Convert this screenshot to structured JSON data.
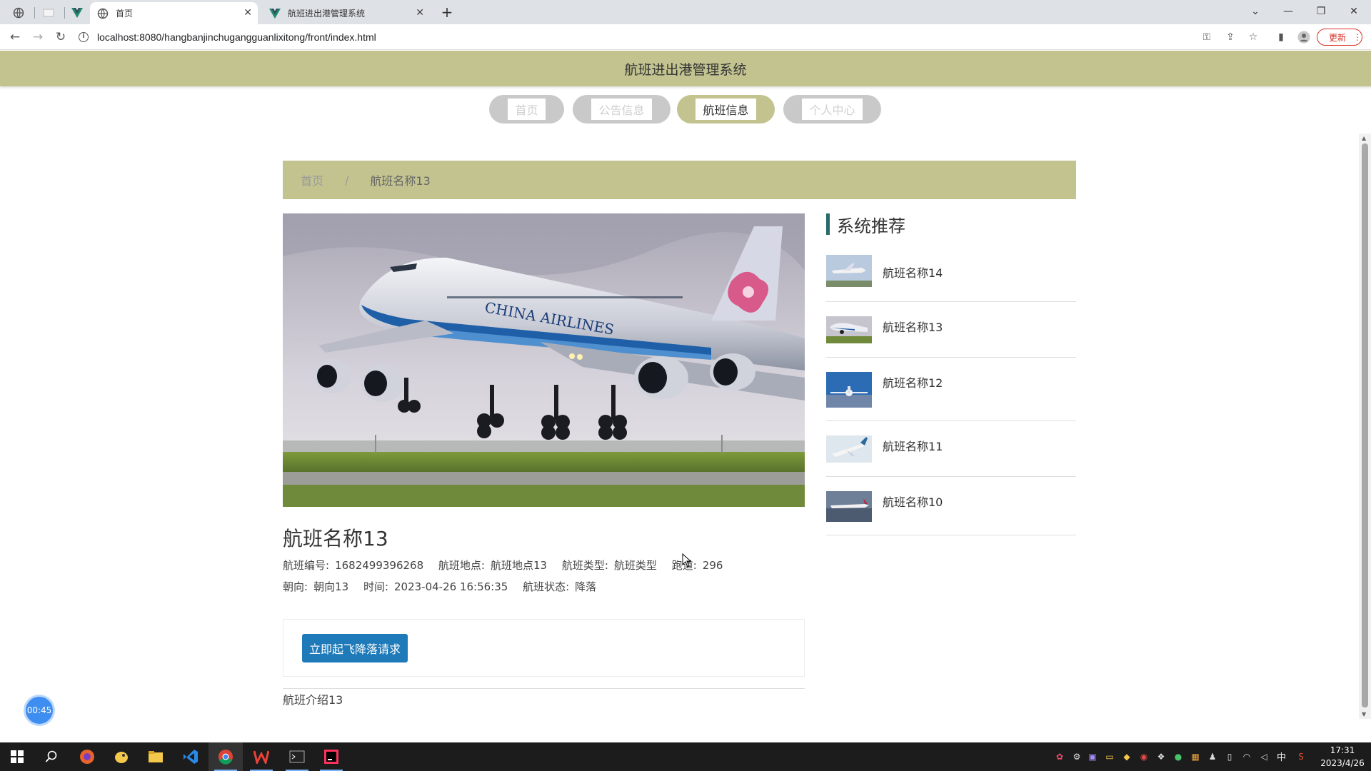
{
  "browser": {
    "tabs": [
      {
        "title": "首页",
        "active": true
      },
      {
        "title": "航班进出港管理系统",
        "active": false
      }
    ],
    "url": "localhost:8080/hangbanjinchugangguanlixitong/front/index.html",
    "update_label": "更新"
  },
  "site": {
    "header_title": "航班进出港管理系统",
    "nav": [
      {
        "label": "首页",
        "active": false
      },
      {
        "label": "公告信息",
        "active": false
      },
      {
        "label": "航班信息",
        "active": true
      },
      {
        "label": "个人中心",
        "active": false
      }
    ]
  },
  "breadcrumb": {
    "home": "首页",
    "separator": "/",
    "current": "航班名称13"
  },
  "detail": {
    "image_alt": "China Airlines Boeing 747 landing",
    "title": "航班名称13",
    "fields": [
      {
        "label": "航班编号:",
        "value": "1682499396268"
      },
      {
        "label": "航班地点:",
        "value": "航班地点13"
      },
      {
        "label": "航班类型:",
        "value": "航班类型"
      },
      {
        "label": "跑道:",
        "value": "296"
      },
      {
        "label": "朝向:",
        "value": "朝向13"
      },
      {
        "label": "时间:",
        "value": "2023-04-26 16:56:35"
      },
      {
        "label": "航班状态:",
        "value": "降落"
      }
    ],
    "action_label": "立即起飞降落请求",
    "intro": "航班介绍13"
  },
  "sidebar": {
    "title": "系统推荐",
    "items": [
      {
        "name": "航班名称14"
      },
      {
        "name": "航班名称13"
      },
      {
        "name": "航班名称12"
      },
      {
        "name": "航班名称11"
      },
      {
        "name": "航班名称10"
      }
    ]
  },
  "timer": "00:45",
  "taskbar": {
    "tray_lang": "中",
    "time": "17:31",
    "date": "2023/4/26"
  },
  "colors": {
    "header_bg": "#c2c38f",
    "nav_inactive": "#c9c9c9",
    "button_blue": "#1e7ab8",
    "sidebar_accent": "#2b6a6c"
  }
}
